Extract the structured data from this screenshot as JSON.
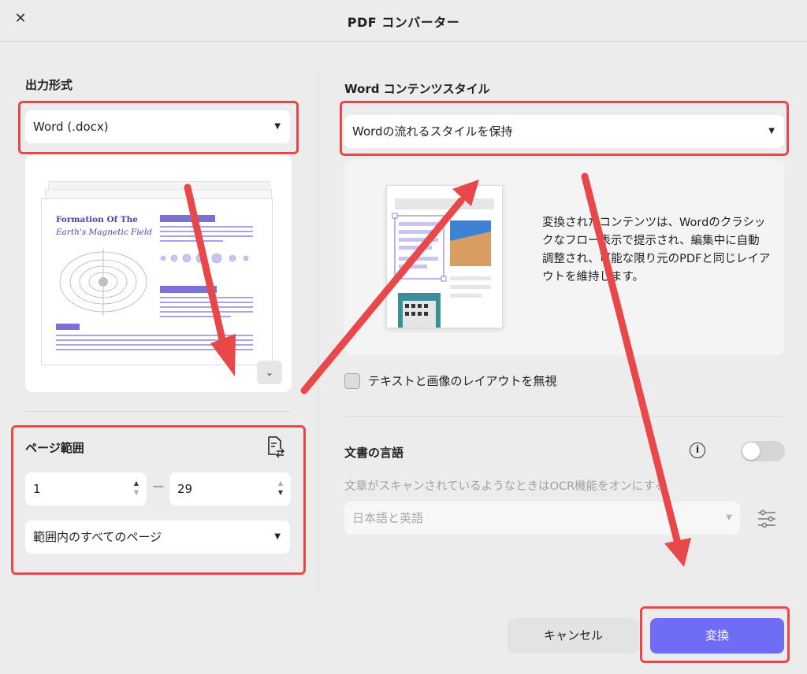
{
  "dialog": {
    "title": "PDF コンバーター"
  },
  "output_format": {
    "label": "出力形式",
    "selected": "Word (.docx)"
  },
  "preview": {
    "doc_title_line1": "Formation Of The",
    "doc_title_line2": "Earth's Magnetic Field"
  },
  "page_range": {
    "label": "ページ範囲",
    "from": "1",
    "to": "29",
    "separator": "—",
    "scope": "範囲内のすべてのページ"
  },
  "content_style": {
    "label": "Word コンテンツスタイル",
    "selected": "Wordの流れるスタイルを保持",
    "description": "変換されたコンテンツは、Wordのクラシックなフロー表示で提示され、編集中に自動調整され、可能な限り元のPDFと同じレイアウトを維持します。"
  },
  "ignore_layout": {
    "label": "テキストと画像のレイアウトを無視",
    "checked": false
  },
  "document_language": {
    "label": "文書の言語",
    "ocr_hint": "文章がスキャンされているようなときはOCR機能をオンにする",
    "selected": "日本語と英語",
    "ocr_enabled": false
  },
  "buttons": {
    "cancel": "キャンセル",
    "convert": "変換"
  },
  "icons": {
    "close": "close-icon",
    "page_swap": "page-swap-icon",
    "info": "info-icon",
    "settings": "sliders-icon",
    "expand": "chevron-down-icon"
  },
  "colors": {
    "accent": "#6f6cf5",
    "highlight": "#e8484a"
  }
}
